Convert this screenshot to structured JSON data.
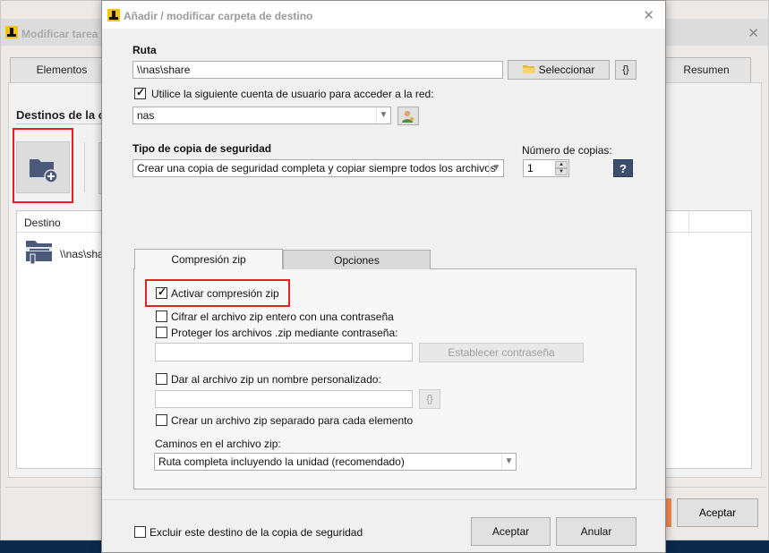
{
  "background": {
    "title": "Modificar tarea",
    "tabs": [
      "Elementos",
      "Resumen"
    ],
    "heading": "Destinos de la c",
    "list_header": "Destino",
    "list_rows": [
      "\\\\nas\\shar"
    ],
    "accept_label": "Aceptar"
  },
  "dialog": {
    "title": "Añadir / modificar carpeta de destino",
    "close_glyph": "✕",
    "path_label": "Ruta",
    "path_value": "\\\\nas\\share",
    "select_button": "Seleccionar",
    "var_button": "{}",
    "use_account_label": "Utilice la siguiente cuenta de usuario para acceder a la red:",
    "account_value": "nas",
    "backup_type_label": "Tipo de copia de seguridad",
    "backup_type_value": "Crear una copia de seguridad completa y copiar siempre todos los archivos",
    "copies_label": "Número de copias:",
    "copies_value": "1",
    "help_glyph": "?",
    "tabs": {
      "zip": "Compresión zip",
      "options": "Opciones"
    },
    "zip": {
      "activate_label": "Activar compresión zip",
      "encrypt_label": "Cifrar el archivo zip entero con una contraseña",
      "protect_label": "Proteger los archivos .zip mediante contraseña:",
      "set_password_button": "Establecer contraseña",
      "custom_name_label": "Dar al archivo zip un nombre personalizado:",
      "custom_name_var_button": "{}",
      "separate_label": "Crear un archivo zip separado para cada elemento",
      "paths_label": "Caminos en el archivo zip:",
      "paths_value": "Ruta completa incluyendo la unidad (recomendado)"
    },
    "exclude_label": "Excluir este destino de la copia de seguridad",
    "accept_button": "Aceptar",
    "cancel_button": "Anular"
  }
}
